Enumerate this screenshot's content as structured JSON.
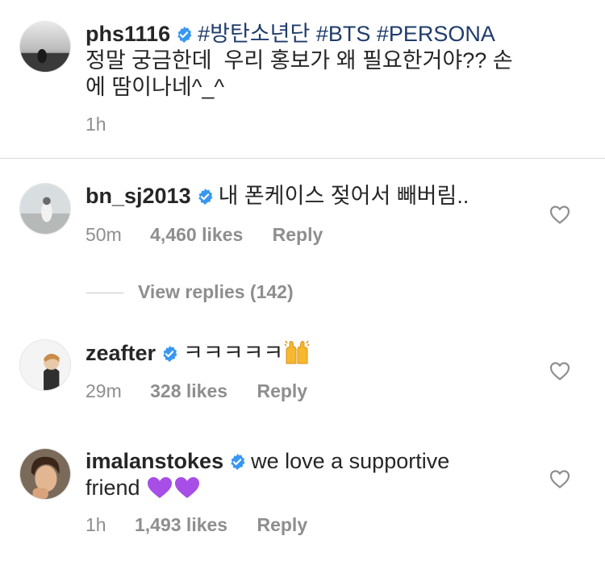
{
  "caption": {
    "username": "phs1116",
    "hashtags": [
      "#방탄소년단",
      "#BTS",
      "#PERSONA"
    ],
    "line1_text": "정말 궁금한데  우리 홍보가 왜 필요한거야?? 손",
    "line2_text": "에 땀이나네^_^",
    "time": "1h"
  },
  "comments": [
    {
      "username": "bn_sj2013",
      "text": "내 폰케이스 젖어서 빼버림..",
      "time": "50m",
      "likes": "4,460 likes",
      "reply": "Reply"
    },
    {
      "username": "zeafter",
      "text": "ㅋㅋㅋㅋㅋ",
      "emoji": "raising-hands",
      "time": "29m",
      "likes": "328 likes",
      "reply": "Reply"
    },
    {
      "username": "imalanstokes",
      "text_line1": "we love a supportive",
      "text_line2": "friend",
      "emoji": "purple-heart",
      "time": "1h",
      "likes": "1,493 likes",
      "reply": "Reply"
    }
  ],
  "view_replies": "View replies (142)",
  "icons": {
    "verified": "verified-badge-icon",
    "heart": "heart-outline-icon"
  },
  "colors": {
    "verified_blue": "#3897f0",
    "hashtag": "#1f3c6b",
    "muted": "#8e8e8e",
    "text": "#262626"
  }
}
